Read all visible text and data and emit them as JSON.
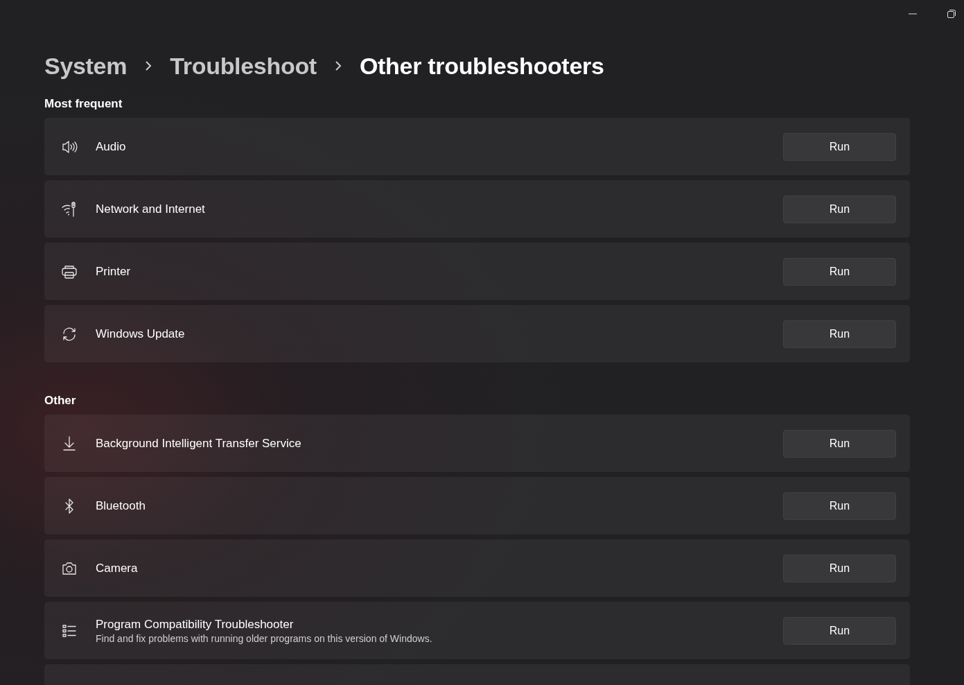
{
  "breadcrumb": [
    {
      "label": "System",
      "current": false
    },
    {
      "label": "Troubleshoot",
      "current": false
    },
    {
      "label": "Other troubleshooters",
      "current": true
    }
  ],
  "sections": [
    {
      "title": "Most frequent",
      "items": [
        {
          "name": "Audio",
          "button": "Run"
        },
        {
          "name": "Network and Internet",
          "button": "Run"
        },
        {
          "name": "Printer",
          "button": "Run"
        },
        {
          "name": "Windows Update",
          "button": "Run"
        }
      ]
    },
    {
      "title": "Other",
      "items": [
        {
          "name": "Background Intelligent Transfer Service",
          "button": "Run"
        },
        {
          "name": "Bluetooth",
          "button": "Run"
        },
        {
          "name": "Camera",
          "button": "Run"
        },
        {
          "name": "Program Compatibility Troubleshooter",
          "description": "Find and fix problems with running older programs on this version of Windows.",
          "button": "Run"
        }
      ]
    }
  ]
}
